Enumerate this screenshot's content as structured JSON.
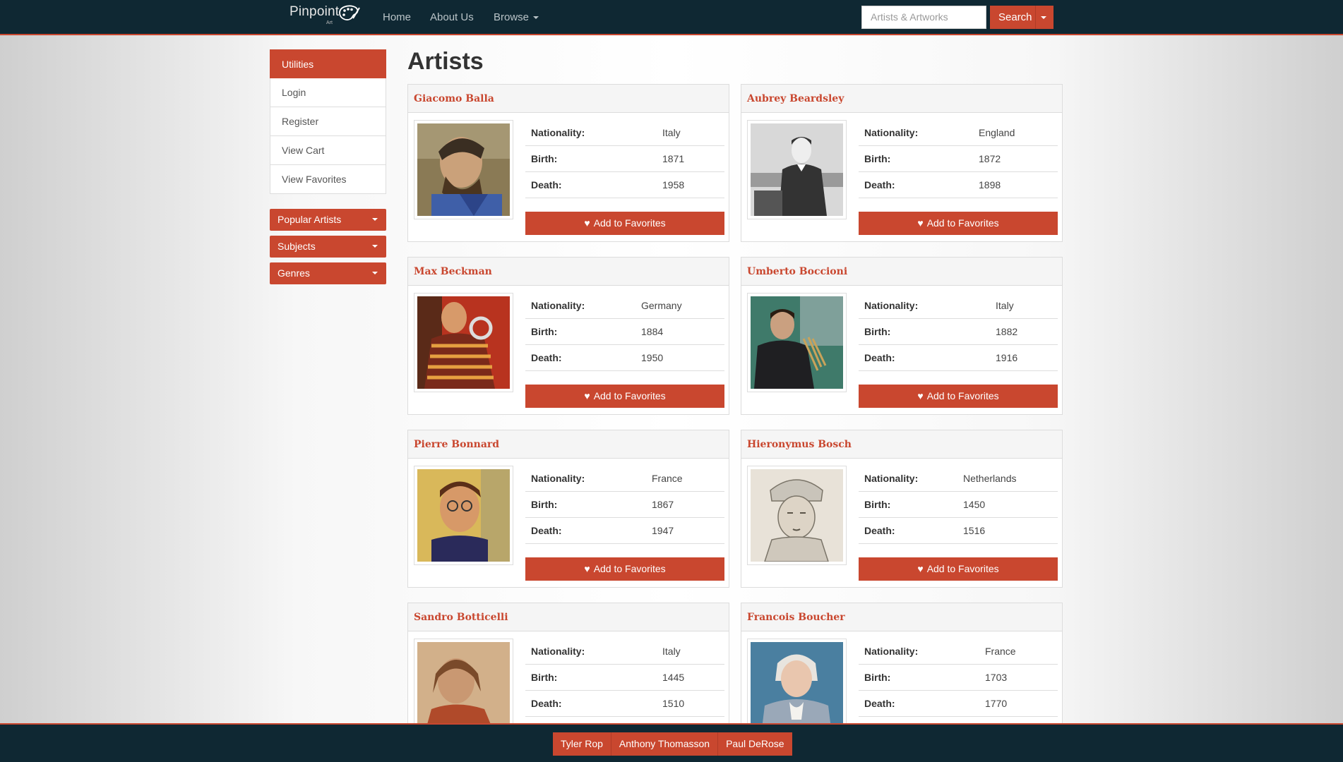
{
  "navbar": {
    "brand": "Pinpoint",
    "brand_sub": "Art",
    "links": [
      "Home",
      "About Us",
      "Browse"
    ],
    "search_placeholder": "Artists & Artworks",
    "search_label": "Search"
  },
  "sidebar": {
    "active": "Utilities",
    "items": [
      "Login",
      "Register",
      "View Cart",
      "View Favorites"
    ],
    "dropdowns": [
      "Popular Artists",
      "Subjects",
      "Genres"
    ]
  },
  "main": {
    "title": "Artists",
    "labels": {
      "nationality": "Nationality:",
      "birth": "Birth:",
      "death": "Death:"
    },
    "favorite_label": "Add to Favorites",
    "artists": [
      {
        "name": "Giacomo Balla",
        "nationality": "Italy",
        "birth": "1871",
        "death": "1958"
      },
      {
        "name": "Aubrey Beardsley",
        "nationality": "England",
        "birth": "1872",
        "death": "1898"
      },
      {
        "name": "Max Beckman",
        "nationality": "Germany",
        "birth": "1884",
        "death": "1950"
      },
      {
        "name": "Umberto Boccioni",
        "nationality": "Italy",
        "birth": "1882",
        "death": "1916"
      },
      {
        "name": "Pierre Bonnard",
        "nationality": "France",
        "birth": "1867",
        "death": "1947"
      },
      {
        "name": "Hieronymus Bosch",
        "nationality": "Netherlands",
        "birth": "1450",
        "death": "1516"
      },
      {
        "name": "Sandro Botticelli",
        "nationality": "Italy",
        "birth": "1445",
        "death": "1510"
      },
      {
        "name": "Francois Boucher",
        "nationality": "France",
        "birth": "1703",
        "death": "1770"
      }
    ]
  },
  "footer": {
    "authors": [
      "Tyler Rop",
      "Anthony Thomasson",
      "Paul DeRose"
    ]
  },
  "colors": {
    "accent": "#c9472f",
    "navbar": "#0f2833"
  }
}
